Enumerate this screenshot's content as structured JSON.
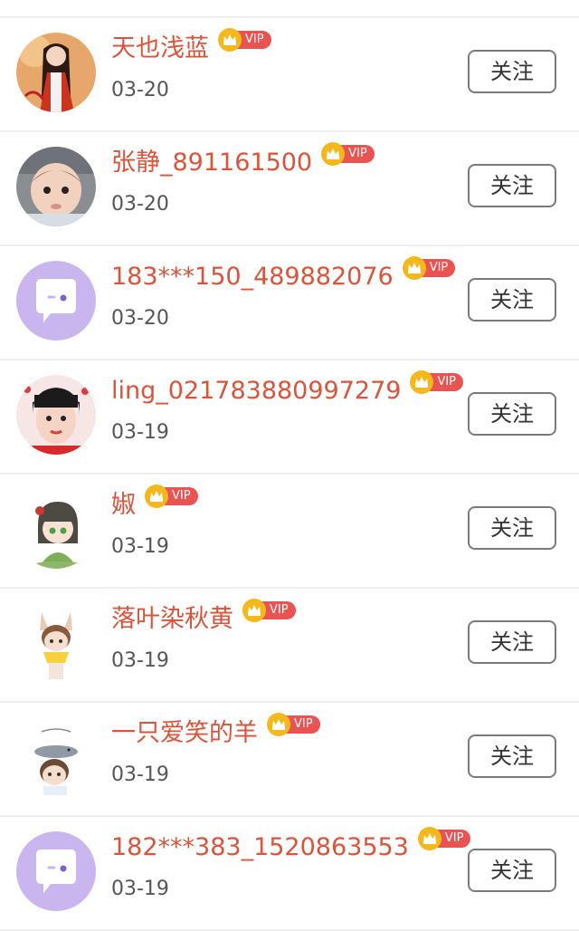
{
  "colors": {
    "name": "#d9543a",
    "date": "#555555",
    "vip_badge": "#e95452",
    "vip_crown": "#f5b81c",
    "button_border": "#7a7a7a",
    "divider": "#eeeeee",
    "default_avatar_bg": "#c9b6ef"
  },
  "vip_label": "VIP",
  "follow_label": "关注",
  "users": [
    {
      "name": "天也浅蓝",
      "date": "03-20",
      "avatar": "illustrated-girl-red-dress"
    },
    {
      "name": "张静_891161500",
      "date": "03-20",
      "avatar": "baby-photo"
    },
    {
      "name": "183***150_489882076",
      "date": "03-20",
      "avatar": "default-chat-bubble"
    },
    {
      "name": "ling_021783880997279",
      "date": "03-19",
      "avatar": "girl-photo"
    },
    {
      "name": "婌",
      "date": "03-19",
      "avatar": "chibi-girl-green"
    },
    {
      "name": "落叶染秋黄",
      "date": "03-19",
      "avatar": "chibi-fox-ears"
    },
    {
      "name": "一只爱笑的羊",
      "date": "03-19",
      "avatar": "chibi-boy-seal"
    },
    {
      "name": "182***383_1520863553",
      "date": "03-19",
      "avatar": "default-chat-bubble"
    }
  ]
}
